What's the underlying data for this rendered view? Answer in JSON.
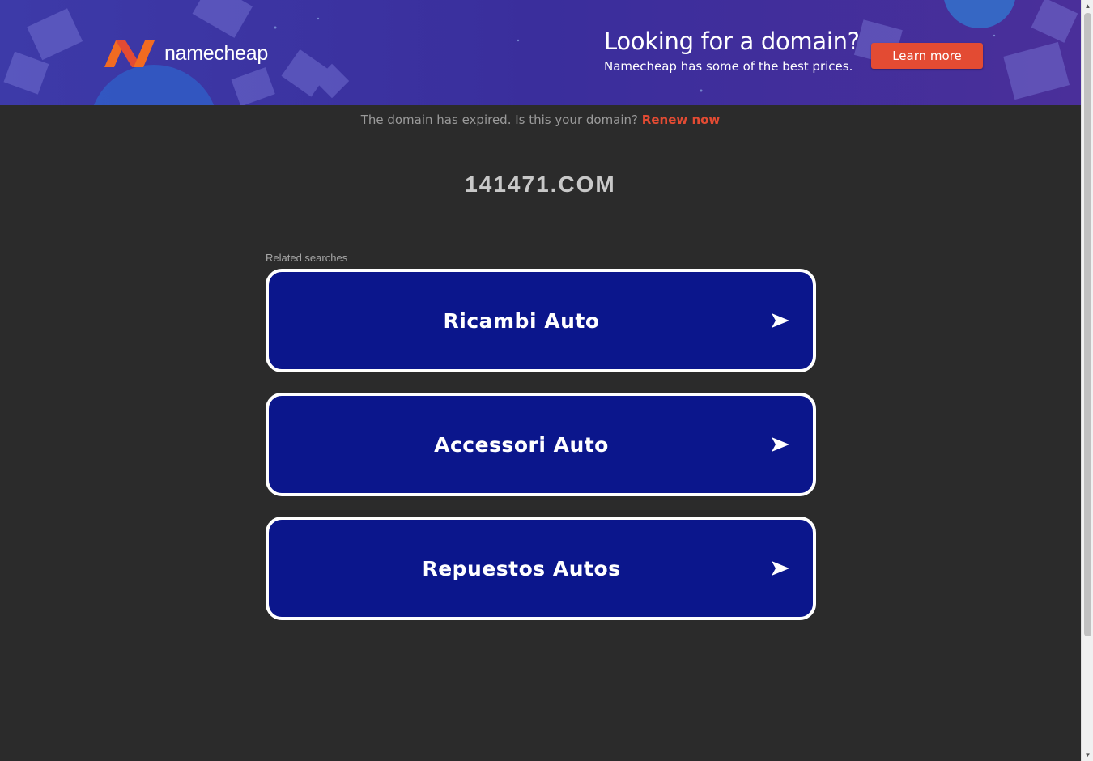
{
  "banner": {
    "brand": "namecheap",
    "title": "Looking for a domain?",
    "subtitle": "Namecheap has some of the best prices.",
    "cta_label": "Learn more",
    "bg_color": "#3b2f9e",
    "cta_color": "#e34b33",
    "logo_colors": [
      "#f26b21",
      "#e34b33"
    ]
  },
  "notice": {
    "text": "The domain has expired. Is this your domain?",
    "link_label": "Renew now",
    "link_color": "#e34b33"
  },
  "domain_name": "141471.COM",
  "related": {
    "label": "Related searches",
    "items": [
      {
        "label": "Ricambi Auto",
        "icon": "arrow-right-icon"
      },
      {
        "label": "Accessori Auto",
        "icon": "arrow-right-icon"
      },
      {
        "label": "Repuestos Autos",
        "icon": "arrow-right-icon"
      }
    ],
    "button_color": "#0b168c"
  },
  "colors": {
    "page_bg": "#2b2b2b"
  }
}
